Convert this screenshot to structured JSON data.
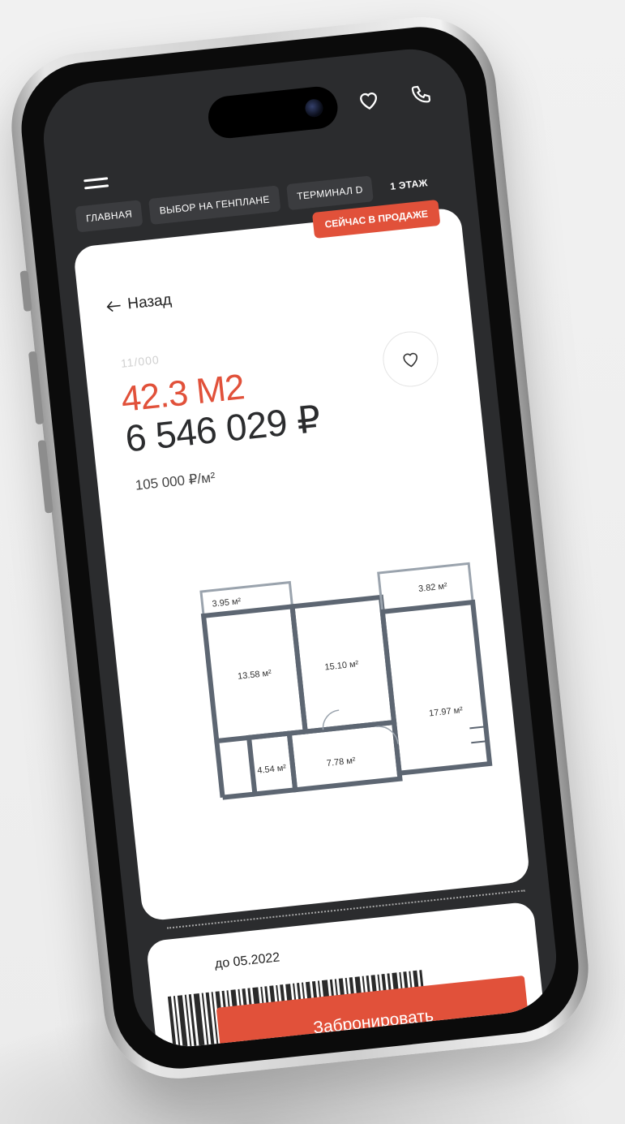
{
  "colors": {
    "accent": "#e1513a",
    "dark": "#2b2c2e",
    "card": "#ffffff"
  },
  "top_icons": [
    "heart-icon",
    "phone-icon"
  ],
  "breadcrumbs": [
    {
      "label": "Главная"
    },
    {
      "label": "Выбор на генплане"
    },
    {
      "label": "Терминал D"
    },
    {
      "label": "1 этаж"
    }
  ],
  "card": {
    "badge": "Сейчас в продаже",
    "back_label": "Назад",
    "code": "11/000",
    "area": "42.3 М2",
    "price": "6 546 029 ₽",
    "price_per_m2": "105 000 ₽/м²",
    "plan_rooms": [
      "3.95 м²",
      "13.58 м²",
      "15.10 м²",
      "3.82 м²",
      "4.54 м²",
      "7.78 м²",
      "17.97 м²"
    ]
  },
  "booking": {
    "deadline": "до 05.2022",
    "button_label": "Забронировать"
  }
}
